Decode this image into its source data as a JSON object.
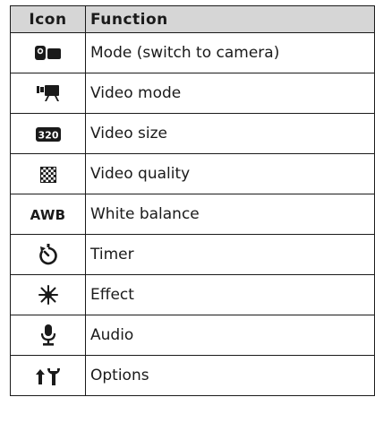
{
  "table": {
    "headers": {
      "icon": "Icon",
      "function": "Function"
    },
    "rows": [
      {
        "icon": "camera-mode-icon",
        "function": "Mode (switch to camera)"
      },
      {
        "icon": "video-mode-icon",
        "function": "Video mode"
      },
      {
        "icon": "video-size-320-icon",
        "icon_text": "320",
        "function": "Video size"
      },
      {
        "icon": "video-quality-icon",
        "function": "Video quality"
      },
      {
        "icon": "white-balance-icon",
        "icon_text": "AWB",
        "function": "White balance"
      },
      {
        "icon": "timer-icon",
        "function": "Timer"
      },
      {
        "icon": "effect-icon",
        "function": "Effect"
      },
      {
        "icon": "microphone-icon",
        "function": "Audio"
      },
      {
        "icon": "options-icon",
        "function": "Options"
      }
    ]
  },
  "colors": {
    "header_background": "#d6d6d6",
    "border": "#1a1a1a",
    "text": "#1a1a1a"
  }
}
